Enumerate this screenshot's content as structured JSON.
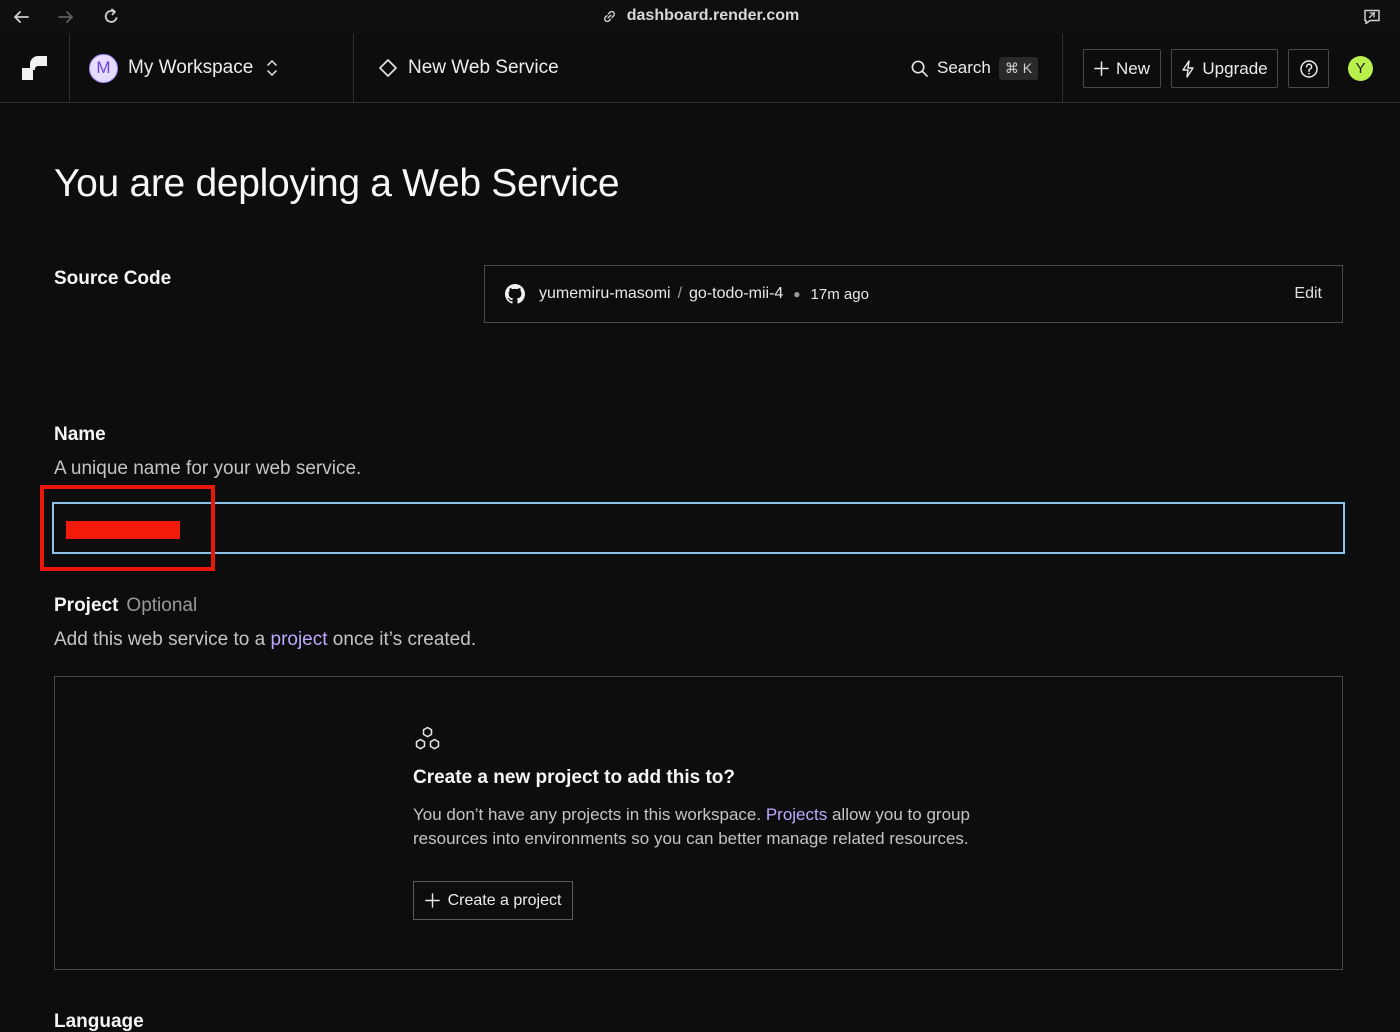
{
  "browser": {
    "url": "dashboard.render.com"
  },
  "header": {
    "workspace": {
      "avatar_initial": "M",
      "name": "My Workspace"
    },
    "page_title": "New Web Service",
    "search": {
      "label": "Search",
      "shortcut": "⌘ K"
    },
    "new_label": "New",
    "upgrade_label": "Upgrade",
    "user_initial": "Y"
  },
  "main": {
    "title": "You are deploying a Web Service",
    "source_code": {
      "label": "Source Code",
      "owner": "yumemiru-masomi",
      "separator": "/",
      "repo": "go-todo-mii-4",
      "age": "17m ago",
      "edit_label": "Edit"
    },
    "name": {
      "label": "Name",
      "description": "A unique name for your web service."
    },
    "project": {
      "label": "Project",
      "optional": "Optional",
      "desc_before": "Add this web service to a ",
      "desc_link": "project",
      "desc_after": " once it’s created.",
      "empty_state": {
        "heading": "Create a new project to add this to?",
        "text_before": "You don’t have any projects in this workspace. ",
        "text_link": "Projects",
        "text_after": " allow you to group resources into environments so you can better manage related resources.",
        "button_label": "Create a project"
      }
    },
    "language": {
      "label": "Language"
    }
  },
  "colors": {
    "background": "#0d0d0d",
    "link": "#bfa8ff",
    "input_focus": "#8cc3ea",
    "annotation_red": "#e8190a",
    "user_avatar": "#b9f04c"
  }
}
